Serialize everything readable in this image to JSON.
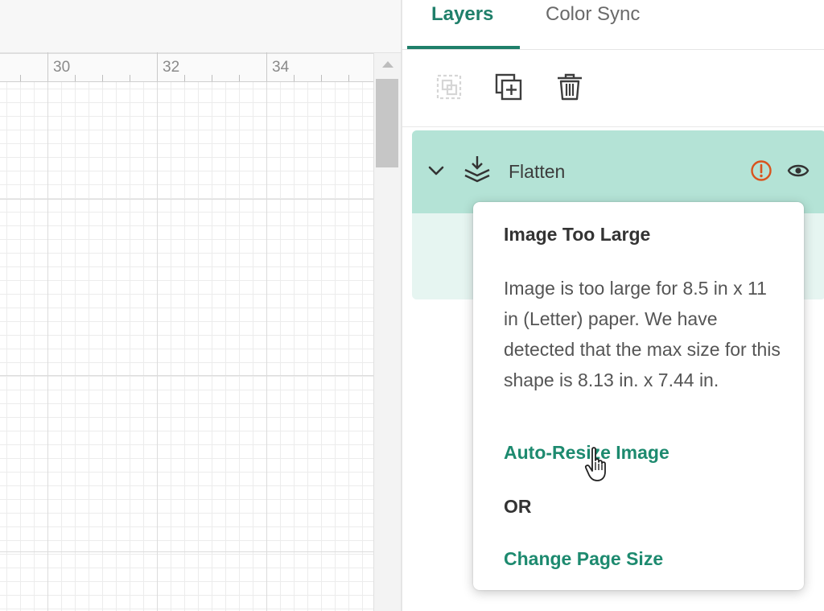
{
  "canvas": {
    "ruler_labels": [
      {
        "text": "30"
      },
      {
        "text": "32"
      },
      {
        "text": "34"
      }
    ]
  },
  "panel": {
    "tabs": [
      {
        "label": "Layers",
        "active": true
      },
      {
        "label": "Color Sync",
        "active": false
      }
    ],
    "toolbar": {
      "icons": [
        "group-icon",
        "duplicate-icon",
        "delete-icon"
      ]
    },
    "layer": {
      "name": "Flatten",
      "icons": [
        "chevron-down-icon",
        "flatten-icon",
        "warning-icon",
        "eye-icon"
      ]
    }
  },
  "popover": {
    "title": "Image Too Large",
    "body": "Image is too large for 8.5 in x 11 in (Letter) paper. We have detected that the max size for this shape is 8.13 in. x 7.44 in.",
    "auto_resize_label": "Auto-Resize Image",
    "or_label": "OR",
    "change_page_label": "Change Page Size"
  },
  "colors": {
    "accent": "#1f7f6a",
    "layer_selected_bg": "#b4e3d6",
    "warning": "#d9541e"
  }
}
